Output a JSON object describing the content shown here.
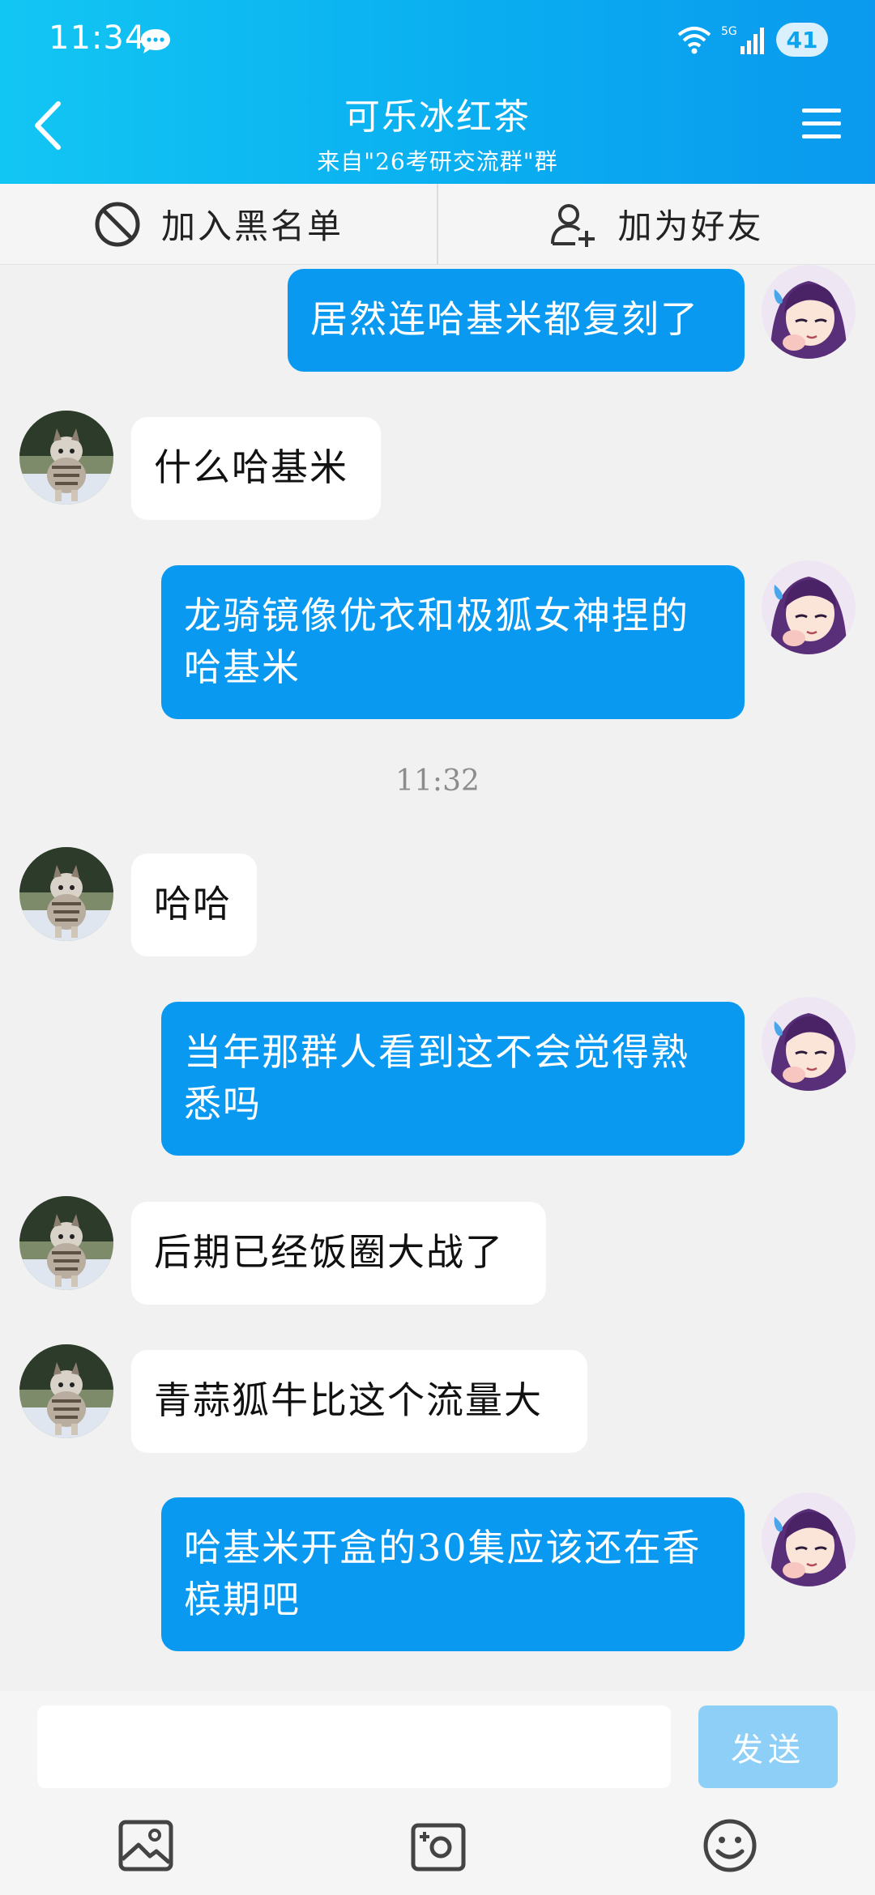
{
  "status_bar": {
    "time": "11:34",
    "network": "5G",
    "battery": "41"
  },
  "header": {
    "title": "可乐冰红茶",
    "subtitle": "来自\"26考研交流群\"群"
  },
  "actions": {
    "block_label": "加入黑名单",
    "add_friend_label": "加为好友"
  },
  "messages": [
    {
      "from": "me",
      "text": "居然连哈基米都复刻了"
    },
    {
      "from": "other",
      "text": "什么哈基米"
    },
    {
      "from": "me",
      "text": "龙骑镜像优衣和极狐女神捏的哈基米"
    },
    {
      "from": "other",
      "text": "哈哈"
    },
    {
      "from": "me",
      "text": "当年那群人看到这不会觉得熟悉吗"
    },
    {
      "from": "other",
      "text": "后期已经饭圈大战了"
    },
    {
      "from": "other",
      "text": "青蒜狐牛比这个流量大"
    },
    {
      "from": "me",
      "text": "哈基米开盒的30集应该还在香槟期吧"
    }
  ],
  "time_separator": "11:32",
  "input": {
    "placeholder": "",
    "send_label": "发送"
  },
  "icons": {
    "chat_status": "chat-bubble-icon",
    "back": "chevron-left-icon",
    "menu": "hamburger-icon",
    "block": "block-icon",
    "add_friend": "add-user-icon",
    "image": "image-icon",
    "camera": "camera-icon",
    "emoji": "emoji-icon"
  },
  "colors": {
    "accent": "#0a99f0",
    "header": "#12c6f3",
    "send_disabled": "#8ecff8"
  }
}
